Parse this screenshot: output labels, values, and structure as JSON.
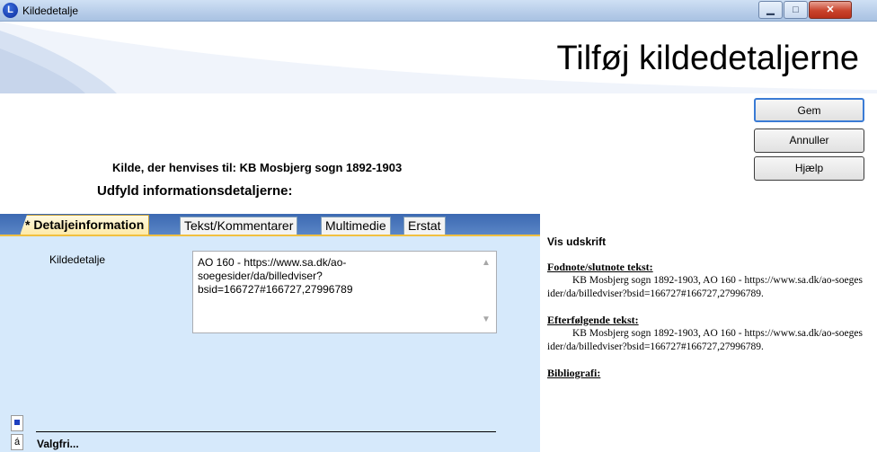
{
  "window": {
    "title": "Kildedetalje",
    "app_icon_letter": "L",
    "min_glyph": "▁",
    "max_glyph": "□",
    "close_glyph": "✕"
  },
  "header": {
    "title": "Tilføj kildedetaljerne"
  },
  "buttons": {
    "save": "Gem",
    "cancel": "Annuller",
    "help": "Hjælp"
  },
  "source_line": "Kilde, der henvises til: KB Mosbjerg sogn 1892-1903",
  "instruction": "Udfyld informationsdetaljerne:",
  "tabs": [
    {
      "label": "* Detaljeinformation",
      "active": true
    },
    {
      "label": "Tekst/Kommentarer",
      "active": false
    },
    {
      "label": "Multimedie",
      "active": false
    },
    {
      "label": "Erstat",
      "active": false
    }
  ],
  "form": {
    "detail_label": "Kildedetalje",
    "detail_value": "AO 160 - https://www.sa.dk/ao-\nsoegesider/da/billedviser?\nbsid=166727#166727,27996789",
    "optional_label": "Valgfri...",
    "side_glyph": "á"
  },
  "preview": {
    "title": "Vis udskrift",
    "footnote_header": "Fodnote/slutnote tekst:",
    "footnote_text": "KB Mosbjerg sogn 1892-1903, AO 160 - https://www.sa.dk/ao-soegesider/da/billedviser?bsid=166727#166727,27996789.",
    "subsequent_header": "Efterfølgende tekst:",
    "subsequent_text": "KB Mosbjerg sogn 1892-1903, AO 160 - https://www.sa.dk/ao-soegesider/da/billedviser?bsid=166727#166727,27996789.",
    "bibliography_header": "Bibliografi:"
  },
  "colors": {
    "tab_strip": "#3c69b2",
    "panel_bg": "#d6e9fb",
    "active_tab": "#fde9a6",
    "banner_blue": "#9fb9dd"
  },
  "icons": [
    "app-icon",
    "minimize-icon",
    "maximize-icon",
    "close-icon",
    "scroll-up-icon",
    "scroll-down-icon"
  ]
}
